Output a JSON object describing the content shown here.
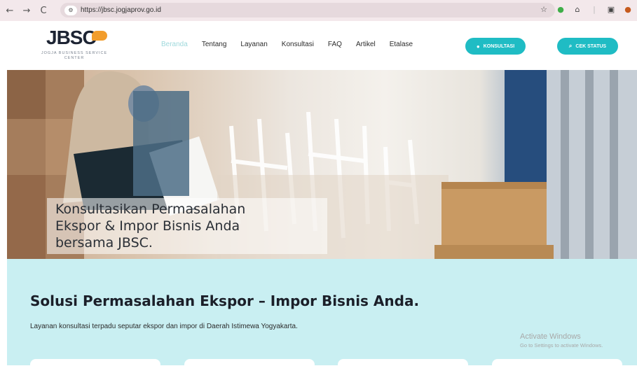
{
  "browser": {
    "url": "https://jbsc.jogjaprov.go.id",
    "site_info_icon": "tune-icon",
    "back_icon": "←",
    "forward_icon": "→",
    "reload_icon": "C"
  },
  "header": {
    "logo_text": "JBSC",
    "logo_sub": "JOGJA BUSINESS SERVICE CENTER",
    "menu": [
      {
        "label": "Beranda",
        "active": true
      },
      {
        "label": "Tentang"
      },
      {
        "label": "Layanan"
      },
      {
        "label": "Konsultasi"
      },
      {
        "label": "FAQ"
      },
      {
        "label": "Artikel"
      },
      {
        "label": "Etalase"
      }
    ],
    "cta_konsultasi": "KONSULTASI",
    "cta_cek_status": "CEK STATUS"
  },
  "hero": {
    "line1": "Konsultasikan Permasalahan",
    "line2": "Ekspor & Impor Bisnis Anda",
    "line3": "bersama JBSC."
  },
  "solution": {
    "title": "Solusi Permasalahan Ekspor – Impor Bisnis Anda.",
    "description": "Layanan konsultasi terpadu seputar ekspor dan impor di Daerah Istimewa Yogyakarta."
  },
  "watermark": {
    "line1": "Activate Windows",
    "line2": "Go to Settings to activate Windows."
  },
  "colors": {
    "accent": "#1fbcc4",
    "menu_active": "#9fd9dc",
    "section_bg": "#c9eff2",
    "logo_orange": "#f29d2c"
  }
}
